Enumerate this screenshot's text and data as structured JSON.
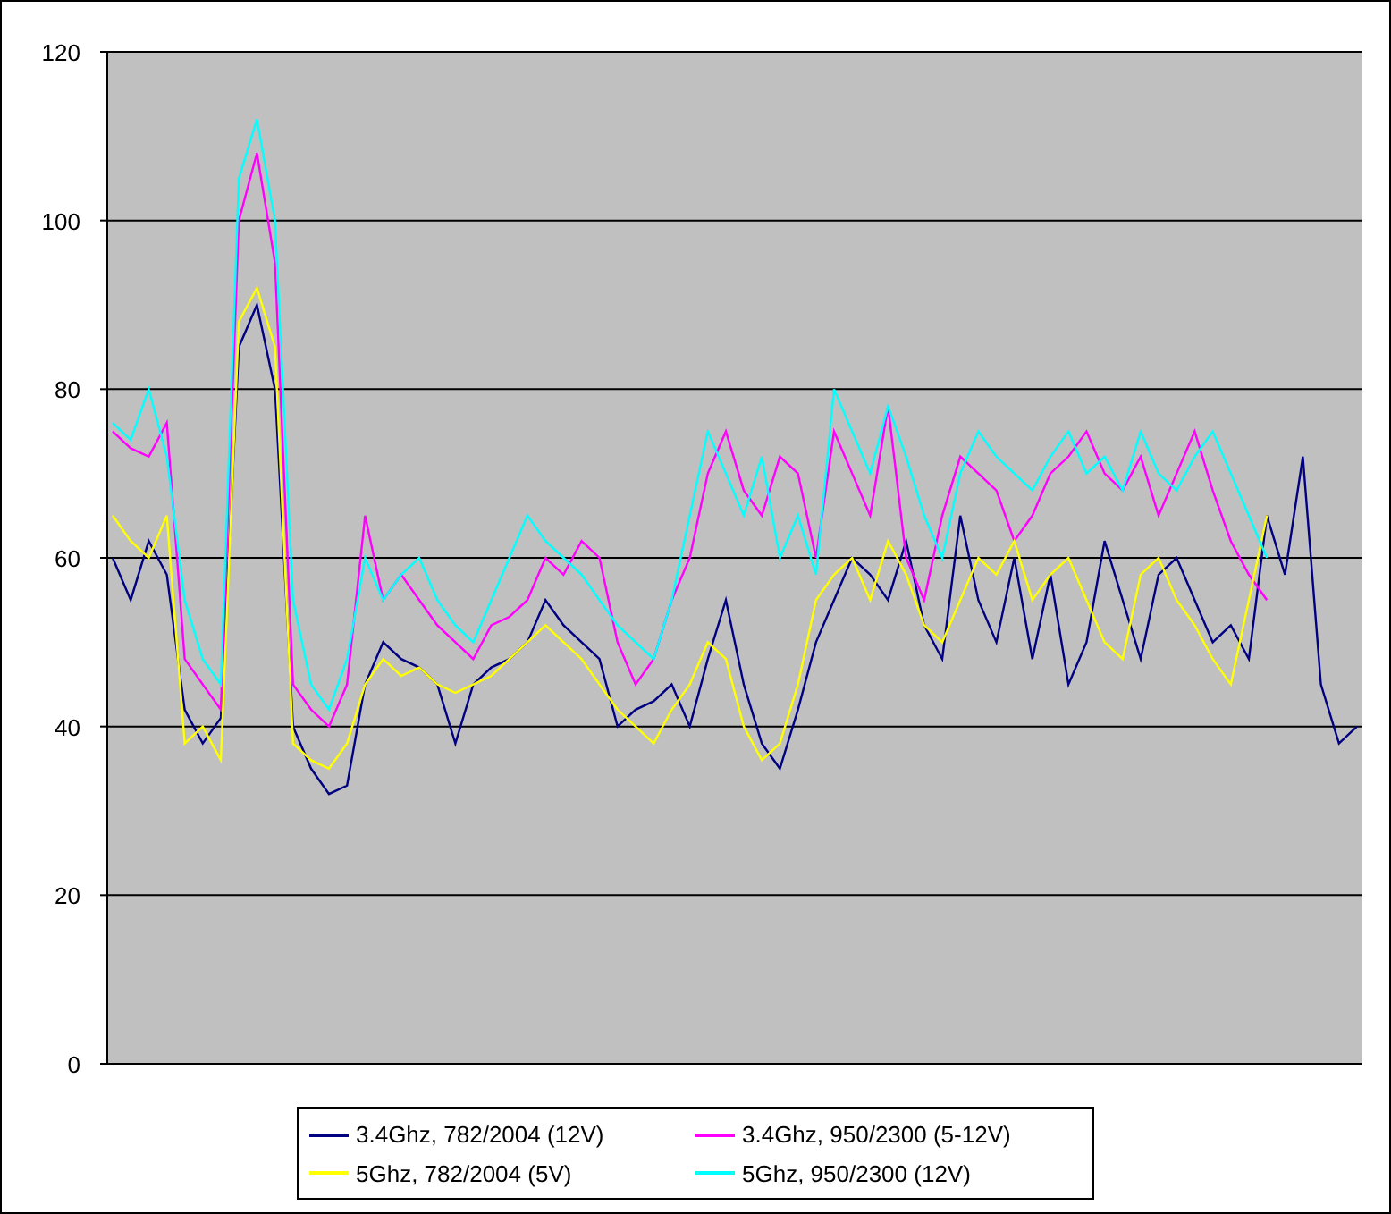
{
  "chart_data": {
    "type": "line",
    "grid": true,
    "legend": true,
    "ylim": [
      0,
      120
    ],
    "yticks": [
      0,
      20,
      40,
      60,
      80,
      100,
      120
    ],
    "series": [
      {
        "name": "3.4Ghz, 782/2004 (12V)",
        "color": "#000080",
        "values": [
          60,
          55,
          62,
          58,
          42,
          38,
          41,
          85,
          90,
          80,
          40,
          35,
          32,
          33,
          45,
          50,
          48,
          47,
          45,
          38,
          45,
          47,
          48,
          50,
          55,
          52,
          50,
          48,
          40,
          42,
          43,
          45,
          40,
          48,
          55,
          45,
          38,
          35,
          42,
          50,
          55,
          60,
          58,
          55,
          62,
          52,
          48,
          65,
          55,
          50,
          60,
          48,
          58,
          45,
          50,
          62,
          55,
          48,
          58,
          60,
          55,
          50,
          52,
          48,
          65,
          58,
          72,
          45,
          38,
          40
        ]
      },
      {
        "name": "3.4Ghz, 950/2300 (5-12V)",
        "color": "#ff00ff",
        "values": [
          75,
          73,
          72,
          76,
          48,
          45,
          42,
          100,
          108,
          95,
          45,
          42,
          40,
          45,
          65,
          55,
          58,
          55,
          52,
          50,
          48,
          52,
          53,
          55,
          60,
          58,
          62,
          60,
          50,
          45,
          48,
          55,
          60,
          70,
          75,
          68,
          65,
          72,
          70,
          60,
          75,
          70,
          65,
          78,
          60,
          55,
          65,
          72,
          70,
          68,
          62,
          65,
          70,
          72,
          75,
          70,
          68,
          72,
          65,
          70,
          75,
          68,
          62,
          58,
          55,
          null,
          null,
          null,
          null,
          null
        ]
      },
      {
        "name": "5Ghz, 782/2004 (5V)",
        "color": "#ffff00",
        "values": [
          65,
          62,
          60,
          65,
          38,
          40,
          36,
          88,
          92,
          85,
          38,
          36,
          35,
          38,
          45,
          48,
          46,
          47,
          45,
          44,
          45,
          46,
          48,
          50,
          52,
          50,
          48,
          45,
          42,
          40,
          38,
          42,
          45,
          50,
          48,
          40,
          36,
          38,
          45,
          55,
          58,
          60,
          55,
          62,
          58,
          52,
          50,
          55,
          60,
          58,
          62,
          55,
          58,
          60,
          55,
          50,
          48,
          58,
          60,
          55,
          52,
          48,
          45,
          55,
          65,
          null,
          null,
          null,
          null,
          null
        ]
      },
      {
        "name": "5Ghz, 950/2300 (12V)",
        "color": "#00ffff",
        "values": [
          76,
          74,
          80,
          72,
          55,
          48,
          45,
          105,
          112,
          100,
          55,
          45,
          42,
          48,
          60,
          55,
          58,
          60,
          55,
          52,
          50,
          55,
          60,
          65,
          62,
          60,
          58,
          55,
          52,
          50,
          48,
          55,
          65,
          75,
          70,
          65,
          72,
          60,
          65,
          58,
          80,
          75,
          70,
          78,
          72,
          65,
          60,
          70,
          75,
          72,
          70,
          68,
          72,
          75,
          70,
          72,
          68,
          75,
          70,
          68,
          72,
          75,
          70,
          65,
          60,
          null,
          null,
          null,
          null,
          null
        ]
      }
    ]
  }
}
